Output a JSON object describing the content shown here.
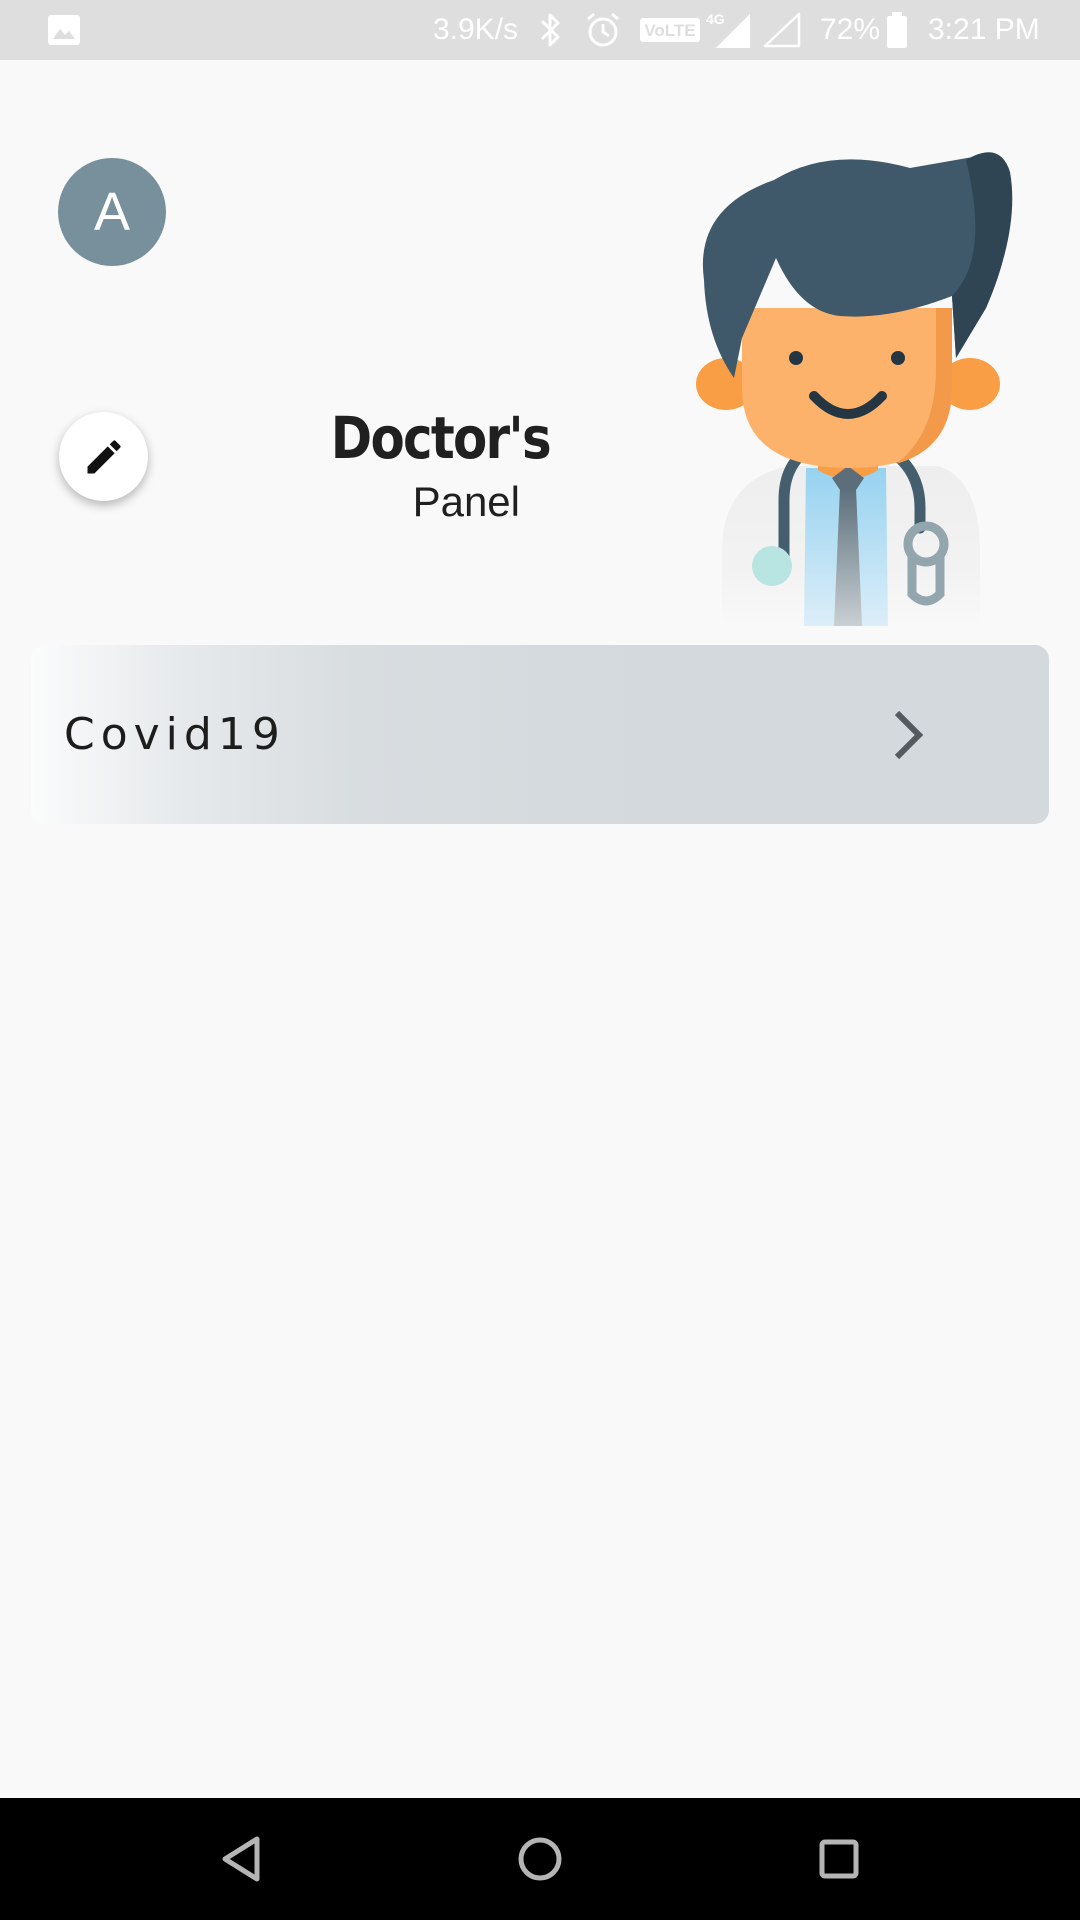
{
  "status_bar": {
    "network_speed": "3.9K/s",
    "network_type": "4G",
    "volte_label": "VoLTE",
    "battery_percent": "72%",
    "time": "3:21 PM",
    "icons": [
      "gallery-icon",
      "bluetooth-icon",
      "alarm-icon",
      "volte-icon",
      "signal-4g-icon",
      "signal-empty-icon",
      "battery-icon"
    ]
  },
  "header": {
    "avatar_initial": "A",
    "title": "Doctor's",
    "subtitle": "Panel",
    "illustration": "doctor-illustration",
    "edit_icon": "pencil-icon"
  },
  "categories": [
    {
      "label": "Covid19",
      "icon": "chevron-right-icon"
    }
  ],
  "navigation": {
    "icons": [
      "back-icon",
      "home-icon",
      "recents-icon"
    ]
  },
  "colors": {
    "avatar_bg": "#78909c",
    "background": "#f9f9f9",
    "card_bg": "#d3d9dd",
    "hair": "#3f596b",
    "skin": "#fcb26b"
  }
}
